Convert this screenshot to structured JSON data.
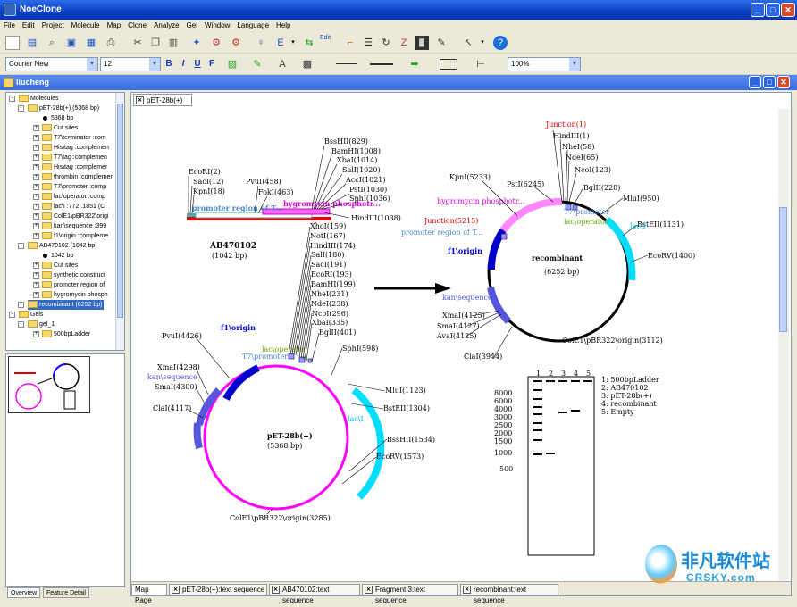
{
  "app": {
    "title": "NoeClone"
  },
  "menu": [
    "File",
    "Edit",
    "Project",
    "Molecule",
    "Map",
    "Clone",
    "Analyze",
    "Gel",
    "Window",
    "Language",
    "Help"
  ],
  "toolbar": {
    "edit_label": "Edit"
  },
  "format": {
    "font": "Courier New",
    "size": "12",
    "zoom": "100%",
    "bold": "B",
    "italic": "I",
    "underline": "U",
    "strike": "F"
  },
  "doc_window": {
    "title": "liucheng"
  },
  "tree": {
    "root": "Molecules",
    "pet": "pET-28b(+) (5368 bp)",
    "pet_items": [
      "5368 bp",
      "Cut sites",
      "T7\\terminator :com",
      "His\\tag :complemen",
      "T7\\tag :complemen",
      "His\\tag :complemer",
      "thrombin :complemen",
      "T7\\promoter :comp",
      "lac\\operator :comp",
      "lac\\I :772..1851 (C",
      "ColE1\\pBR322\\origi",
      "kan\\sequence :399",
      "f1\\origin :compleme"
    ],
    "ab": "AB470102 (1042 bp)",
    "ab_items": [
      "1042 bp",
      "Cut sites",
      "synthetic construct",
      "promoter region of",
      "hygromycin phosph"
    ],
    "recomb": "recombinant (6252 bp)",
    "gels": "Gels",
    "gel1": "gel_1",
    "ladder": "500bpLadder"
  },
  "left_tabs": [
    "Overview",
    "Feature Detail"
  ],
  "main_tab": "pET-28b(+)",
  "bottom_tabs": [
    "Map Page",
    "pET-28b(+):text sequence",
    "AB470102:text sequence",
    "Fragment 3:text sequence",
    "recombinant:text sequence"
  ],
  "map": {
    "ab": {
      "name": "AB470102",
      "size": "(1042 bp)",
      "sites": [
        "EcoRI(2)",
        "SacI(12)",
        "KpnI(18)",
        "PvuI(458)",
        "FokI(463)",
        "BssHII(829)",
        "BamHI(1008)",
        "XbaI(1014)",
        "SalI(1020)",
        "AccI(1021)",
        "PstI(1030)",
        "SphI(1036)",
        "HindIII(1038)"
      ],
      "feature1": "promoter region of T...",
      "feature2": "hygromycin phosphotr..."
    },
    "pet": {
      "name": "pET-28b(+)",
      "size": "(5368 bp)",
      "sites_top": [
        "XhoI(159)",
        "NotI(167)",
        "HindIII(174)",
        "SalI(180)",
        "SacI(191)",
        "EcoRI(193)",
        "BamHI(199)",
        "NheI(231)",
        "NdeI(238)",
        "NcoI(296)",
        "XbaI(335)",
        "BglII(401)"
      ],
      "sphi": "SphI(598)",
      "pvui": "PvuI(4426)",
      "xmai": "XmaI(4298)",
      "smai": "SmaI(4300)",
      "clai": "ClaI(4117)",
      "mlui": "MluI(1123)",
      "bstEII": "BstEII(1304)",
      "bsshII": "BssHII(1534)",
      "ecorv": "EcoRV(1573)",
      "cole1": "ColE1\\pBR322\\origin(3285)",
      "f1": "f1\\origin",
      "lacop": "lac\\operator",
      "t7": "T7\\promoter",
      "kan": "kan\\sequence",
      "laci": "lac\\I"
    },
    "rec": {
      "name": "recombinant",
      "size": "(6252 bp)",
      "junction1": "Junction(1)",
      "hindIII": "HindIII(1)",
      "nhei": "NheI(58)",
      "ndei": "NdeI(65)",
      "ncoi": "NcoI(123)",
      "bglII": "BglII(228)",
      "mlui": "MluI(950)",
      "bstEII": "BstEII(1131)",
      "ecorv": "EcoRV(1400)",
      "kpni": "KpnI(5233)",
      "psti": "PstI(6245)",
      "hyg": "hygromycin phosphotr...",
      "junction2": "Junction(5215)",
      "promoter": "promoter region of T...",
      "f1": "f1\\origin",
      "t7": "T7\\promoter",
      "lacop": "lac\\operator",
      "laci": "lac\\I",
      "kan": "kan\\sequence",
      "xmai": "XmaI(4125)",
      "smai": "SmaI(4127)",
      "avai": "AvaI(4125)",
      "clai": "ClaI(3944)",
      "cole1": "ColE1\\pBR322\\origin(3112)"
    }
  },
  "gel": {
    "lanes": [
      "1",
      "2",
      "3",
      "4",
      "5"
    ],
    "markers": [
      "8000",
      "6000",
      "4000",
      "3000",
      "2500",
      "2000",
      "1500",
      "1000",
      "500"
    ],
    "legend": [
      "1: 500bpLadder",
      "2: AB470102",
      "3: pET-28b(+)",
      "4: recombinant",
      "5: Empty"
    ]
  },
  "watermark": {
    "main": "非凡软件站",
    "sub": "CRSKY.com"
  }
}
